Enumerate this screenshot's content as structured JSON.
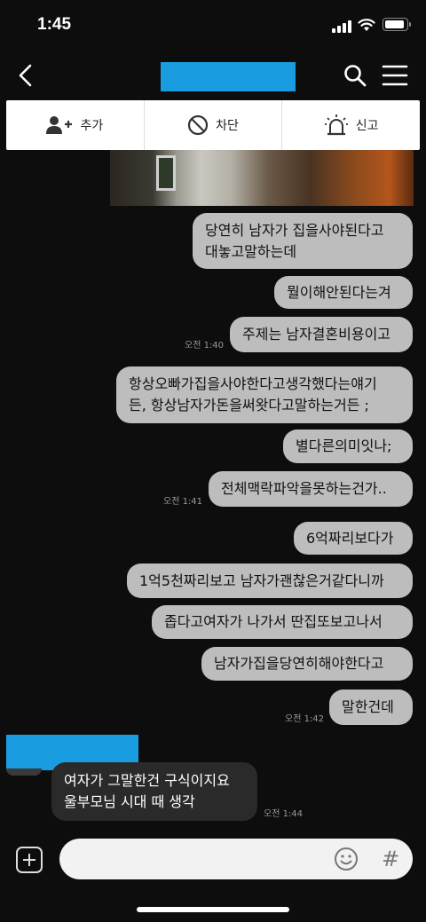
{
  "status_bar": {
    "time": "1:45",
    "battery_level": 0.9
  },
  "header": {
    "back_icon": "chevron-left-icon",
    "search_icon": "search-icon",
    "menu_icon": "hamburger-menu-icon"
  },
  "action_bar": {
    "items": [
      {
        "label": "추가",
        "icon": "add-friend-icon"
      },
      {
        "label": "차단",
        "icon": "block-icon"
      },
      {
        "label": "신고",
        "icon": "report-siren-icon"
      }
    ]
  },
  "messages": {
    "m1": {
      "lines": [
        "당연히 남자가 집을사야된다고",
        "대놓고말하는데"
      ]
    },
    "m2": {
      "text": "뭘이해안된다는겨"
    },
    "m3": {
      "text": "주제는 남자결혼비용이고",
      "time": "오전 1:40"
    },
    "m4": {
      "lines": [
        "항상오빠가집을사야한다고생각했다는얘기",
        "든, 항상남자가돈을써왓다고말하는거든 ;"
      ]
    },
    "m5": {
      "text": "별다른의미잇나;"
    },
    "m6": {
      "text": "전체맥락파악을못하는건가..",
      "time": "오전 1:41"
    },
    "m7": {
      "text": "6억짜리보다가"
    },
    "m8": {
      "text": "1억5천짜리보고 남자가괜찮은거같다니까"
    },
    "m9": {
      "text": "좁다고여자가 나가서 딴집또보고나서"
    },
    "m10": {
      "text": "남자가집을당연히해야한다고"
    },
    "m11": {
      "text": "말한건데",
      "time": "오전 1:42"
    },
    "reply": {
      "lines": [
        "여자가 그말한건 구식이지요",
        "울부모님 시대 때 생각"
      ],
      "time": "오전 1:44"
    }
  },
  "input": {
    "value": "",
    "emoji_icon": "emoji-icon",
    "hash_label": "#"
  },
  "colors": {
    "outgoing_bubble": "#bdbdbd",
    "incoming_bubble": "#2a2a2a",
    "redaction": "#1a9de0"
  }
}
